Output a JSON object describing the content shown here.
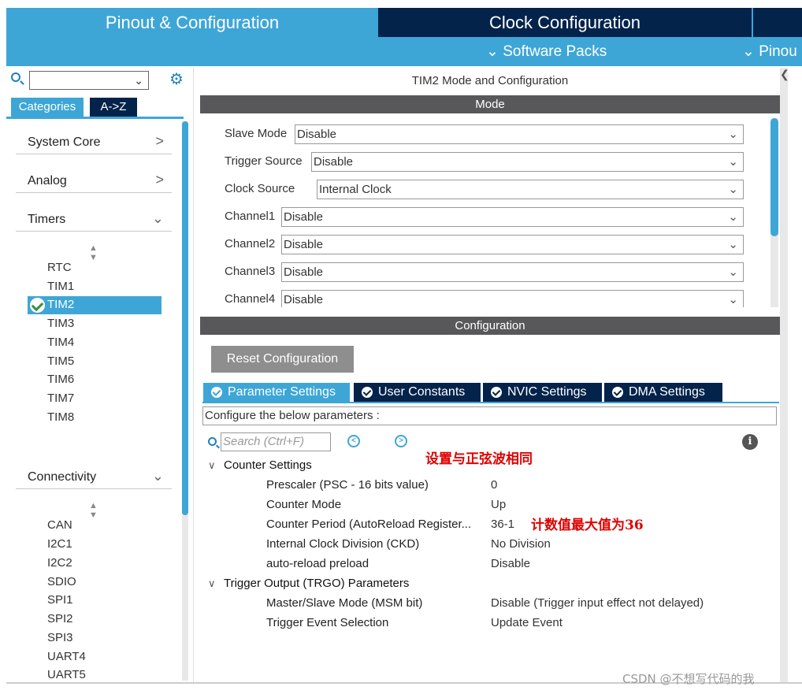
{
  "top_tabs": {
    "pinout": "Pinout & Configuration",
    "clock": "Clock Configuration",
    "software_packs": "⌄ Software Packs",
    "pinout_sub": "⌄ Pinou"
  },
  "left": {
    "tab_categories": "Categories",
    "tab_az": "A->Z",
    "categories": [
      {
        "label": "System Core",
        "chevron": ">"
      },
      {
        "label": "Analog",
        "chevron": ">"
      },
      {
        "label": "Timers",
        "chevron": "⌄"
      },
      {
        "label": "Connectivity",
        "chevron": "⌄"
      }
    ],
    "timers": [
      "RTC",
      "TIM1",
      "TIM2",
      "TIM3",
      "TIM4",
      "TIM5",
      "TIM6",
      "TIM7",
      "TIM8"
    ],
    "connectivity": [
      "CAN",
      "I2C1",
      "I2C2",
      "SDIO",
      "SPI1",
      "SPI2",
      "SPI3",
      "UART4",
      "UART5"
    ],
    "selected_timer": "TIM2"
  },
  "right": {
    "title": "TIM2 Mode and Configuration",
    "mode_header": "Mode",
    "config_header": "Configuration",
    "mode_rows": [
      {
        "label": "Slave Mode",
        "value": "Disable"
      },
      {
        "label": "Trigger Source",
        "value": "Disable"
      },
      {
        "label": "Clock Source",
        "value": "Internal Clock"
      },
      {
        "label": "Channel1",
        "value": "Disable"
      },
      {
        "label": "Channel2",
        "value": "Disable"
      },
      {
        "label": "Channel3",
        "value": "Disable"
      },
      {
        "label": "Channel4",
        "value": "Disable"
      }
    ],
    "reset_button": "Reset Configuration",
    "param_tabs": [
      "Parameter Settings",
      "User Constants",
      "NVIC Settings",
      "DMA Settings"
    ],
    "configure_text": "Configure the below parameters :",
    "search_placeholder": "Search (Ctrl+F)",
    "info_icon": "i",
    "groups": [
      {
        "title": "Counter Settings",
        "rows": [
          {
            "label": "Prescaler (PSC - 16 bits value)",
            "value": "0"
          },
          {
            "label": "Counter Mode",
            "value": "Up"
          },
          {
            "label": "Counter Period (AutoReload Register...",
            "value": "36-1"
          },
          {
            "label": "Internal Clock Division (CKD)",
            "value": "No Division"
          },
          {
            "label": "auto-reload preload",
            "value": "Disable"
          }
        ]
      },
      {
        "title": "Trigger Output (TRGO) Parameters",
        "rows": [
          {
            "label": "Master/Slave Mode (MSM bit)",
            "value": "Disable (Trigger input effect not delayed)"
          },
          {
            "label": "Trigger Event Selection",
            "value": "Update Event"
          }
        ]
      }
    ],
    "annotation_1": "设置与正弦波相同",
    "annotation_2": "计数值最大值为36"
  },
  "watermark": "CSDN @不想写代码的我",
  "colors": {
    "accent": "#3ea6d6",
    "dark": "#03234b",
    "section": "#58585a",
    "annotation": "#e00000"
  }
}
